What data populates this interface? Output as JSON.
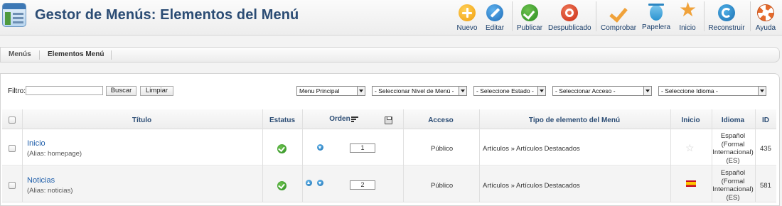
{
  "header": {
    "title": "Gestor de Menús: Elementos del Menú",
    "toolbar": [
      {
        "label": "Nuevo",
        "icon": "plus-circle-icon"
      },
      {
        "label": "Editar",
        "icon": "pencil-icon"
      },
      {
        "label": "Publicar",
        "icon": "check-circle-icon"
      },
      {
        "label": "Despublicado",
        "icon": "stop-circle-icon"
      },
      {
        "label": "Comprobar",
        "icon": "checkmark-icon"
      },
      {
        "label": "Papelera",
        "icon": "trash-icon"
      },
      {
        "label": "Inicio",
        "icon": "star-icon"
      },
      {
        "label": "Reconstruir",
        "icon": "refresh-icon"
      },
      {
        "label": "Ayuda",
        "icon": "lifebuoy-icon"
      }
    ]
  },
  "submenu": {
    "items": [
      "Menús",
      "Elementos Menú"
    ]
  },
  "filter": {
    "label": "Filtro:",
    "value": "",
    "search_button": "Buscar",
    "clear_button": "Limpiar",
    "selects": [
      "Menu Principal",
      "- Seleccionar Nivel de Menú -",
      "- Seleccione Estado -",
      "- Seleccionar Acceso -",
      "- Seleccione Idioma -"
    ]
  },
  "table": {
    "headers": {
      "title": "Título",
      "status": "Estatus",
      "order": "Orden",
      "access": "Acceso",
      "type": "Tipo de elemento del Menú",
      "home": "Inicio",
      "language": "Idioma",
      "id": "ID"
    },
    "rows": [
      {
        "title": "Inicio",
        "alias": "(Alias: homepage)",
        "status": "published",
        "order": "1",
        "access": "Público",
        "type": "Artículos » Artículos Destacados",
        "home": "not-default",
        "language": [
          "Español",
          "(Formal",
          "Internacional)",
          "(ES)"
        ],
        "id": "435"
      },
      {
        "title": "Noticias",
        "alias": "(Alias: noticias)",
        "status": "published",
        "order": "2",
        "access": "Público",
        "type": "Artículos » Artículos Destacados",
        "home": "spain-flag",
        "language": [
          "Español",
          "(Formal",
          "Internacional)",
          "(ES)"
        ],
        "id": "581"
      }
    ]
  },
  "colors": {
    "title": "#2b4c74",
    "link": "#1e5eaa",
    "published": "#2a8c20"
  }
}
